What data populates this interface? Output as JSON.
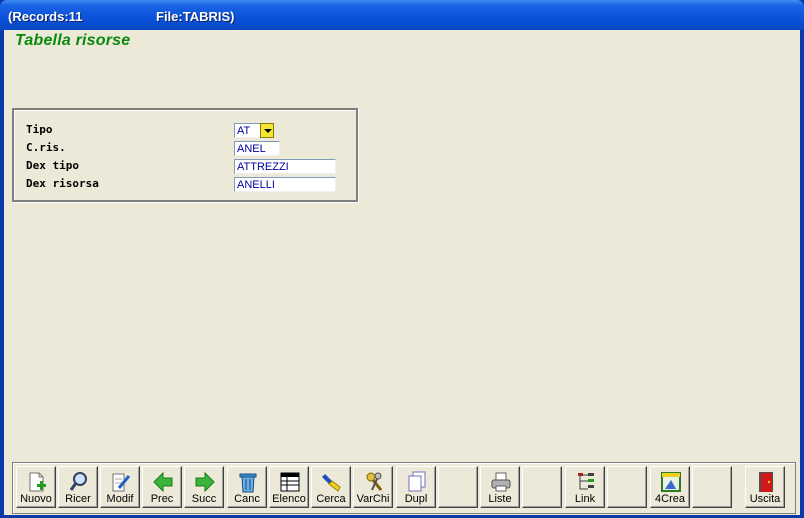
{
  "window": {
    "records": "(Records:11",
    "file": "File:TABRIS)"
  },
  "form": {
    "title": "Tabella risorse",
    "fields": [
      {
        "label": "Tipo",
        "value": "AT"
      },
      {
        "label": "C.ris.",
        "value": "ANEL"
      },
      {
        "label": "Dex tipo",
        "value": "ATTREZZI"
      },
      {
        "label": "Dex risorsa",
        "value": "ANELLI"
      }
    ]
  },
  "toolbar": {
    "nuovo": "Nuovo",
    "ricer": "Ricer",
    "modif": "Modif",
    "prec": "Prec",
    "succ": "Succ",
    "canc": "Canc",
    "elenco": "Elenco",
    "cerca": "Cerca",
    "varchi": "VarChi",
    "dupl": "Dupl",
    "liste": "Liste",
    "link": "Link",
    "crea": "4Crea",
    "uscita": "Uscita"
  }
}
